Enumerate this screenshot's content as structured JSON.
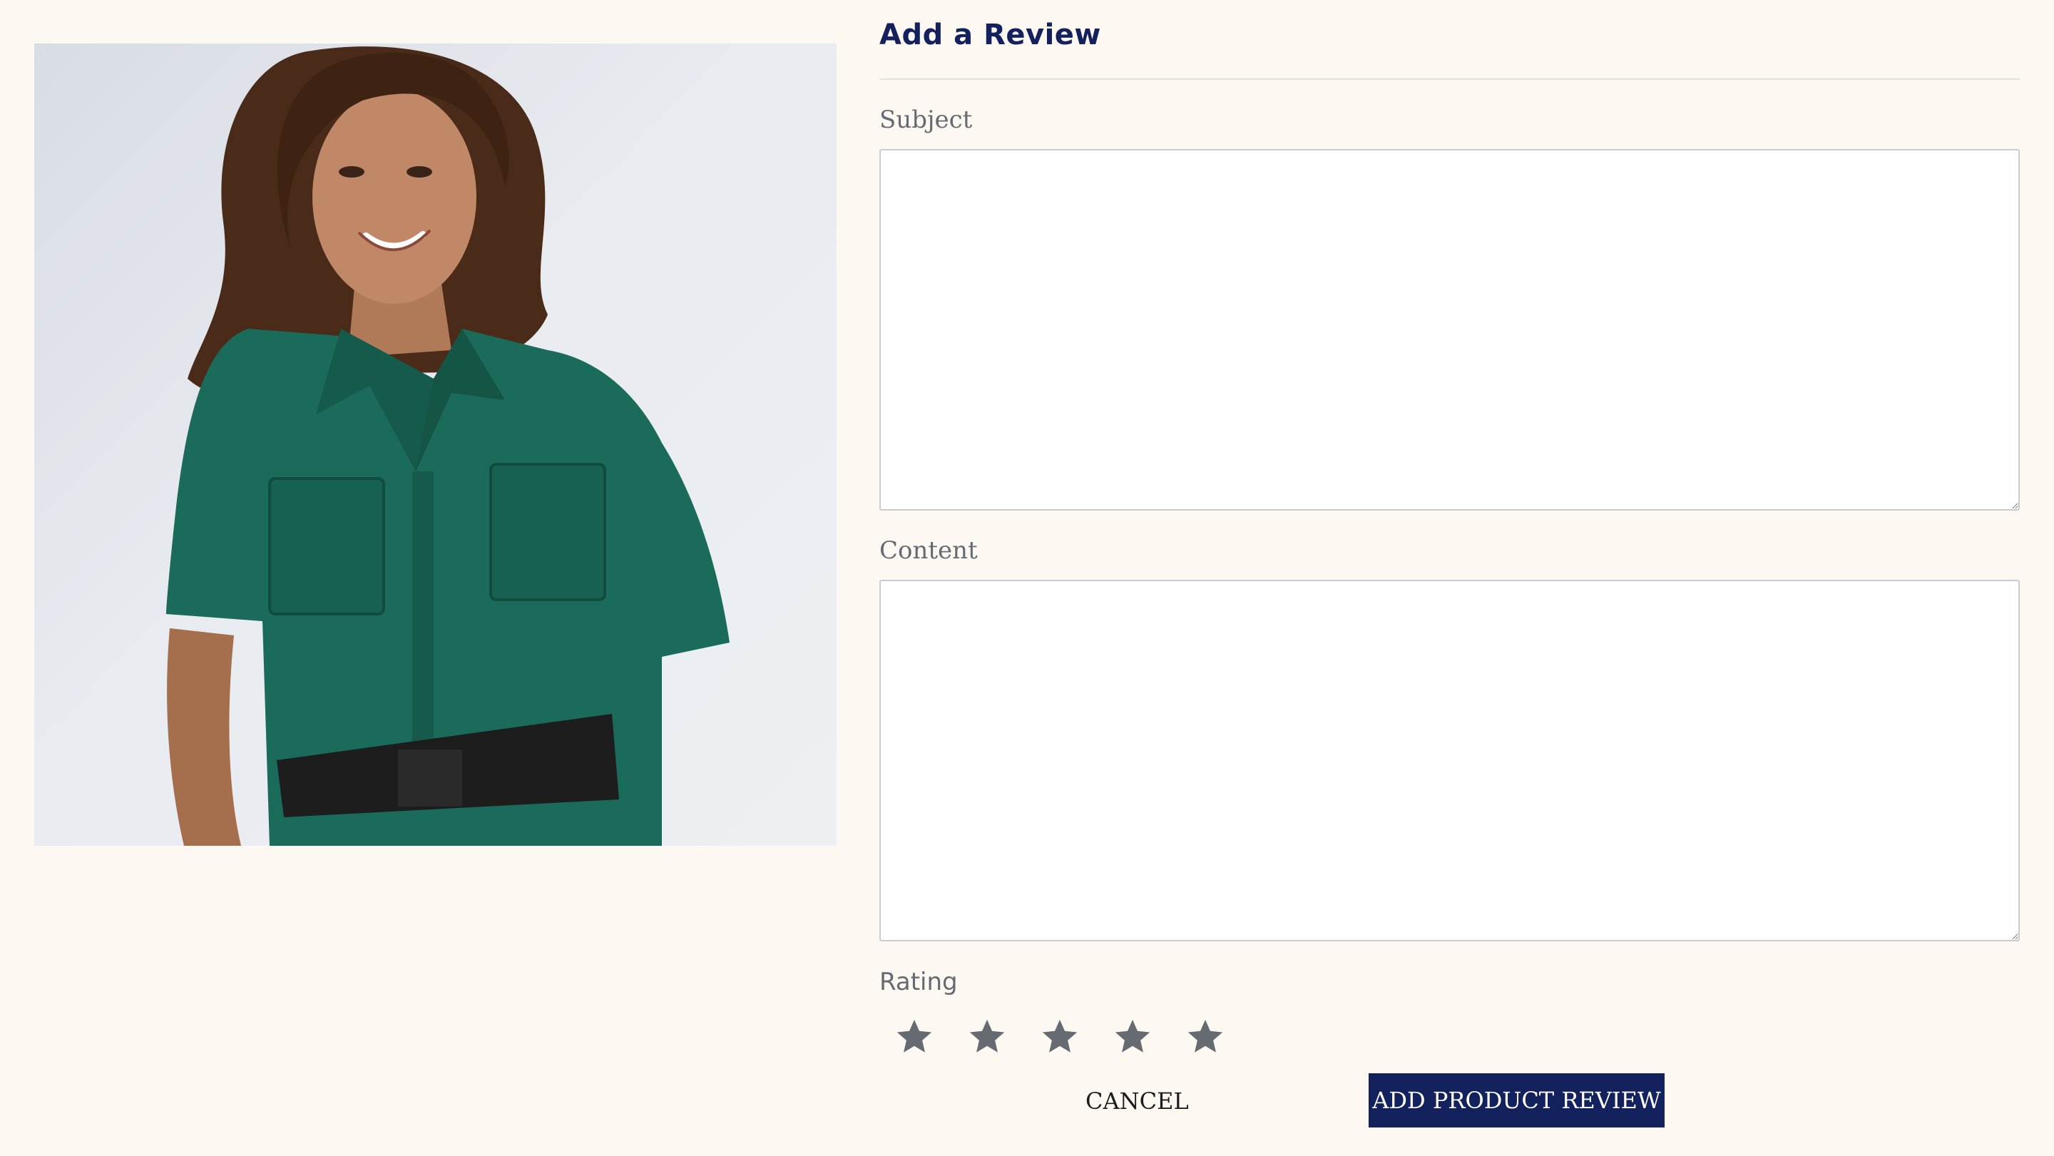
{
  "form": {
    "title": "Add a Review",
    "subject": {
      "label": "Subject",
      "value": ""
    },
    "content": {
      "label": "Content",
      "value": ""
    },
    "rating": {
      "label": "Rating",
      "max": 5,
      "value": 0
    },
    "cancel_label": "CANCEL",
    "submit_label": "ADD PRODUCT REVIEW"
  },
  "colors": {
    "accent": "#13215c",
    "background": "#fdf8f2",
    "star": "#666b72"
  }
}
